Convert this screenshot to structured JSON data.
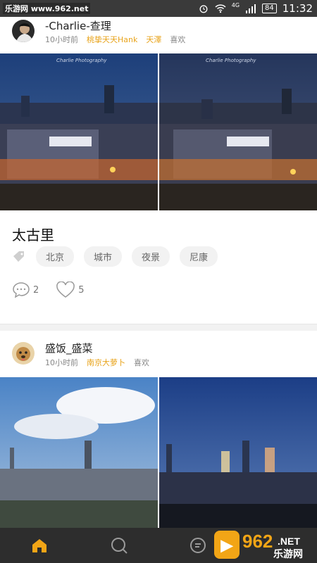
{
  "status_bar": {
    "watermark": "乐游网 www.962.net",
    "network": "4G",
    "battery": "84",
    "time": "11:32"
  },
  "posts": [
    {
      "user": "-Charlie-查理",
      "time": "10小时前",
      "likers": [
        "桃挚天天Hank",
        "天澤"
      ],
      "like_suffix": "喜欢",
      "photo_caption": "Charlie Photography",
      "title": "太古里",
      "tags": [
        "北京",
        "城市",
        "夜景",
        "尼康"
      ],
      "comments": "2",
      "likes": "5"
    },
    {
      "user": "盛饭_盛菜",
      "time": "10小时前",
      "likers": [
        "南京大萝卜"
      ],
      "like_suffix": "喜欢"
    }
  ],
  "nav": {
    "icons": [
      "home-icon",
      "search-icon",
      "message-icon"
    ],
    "accent": "#f2a516"
  },
  "brand": {
    "logo_text": "962",
    "logo_sub": ".NET",
    "logo_caption": "乐游网"
  },
  "colors": {
    "highlight": "#e8a31a",
    "statusbar": "#3a3a3a",
    "navbar": "#2d2d2d"
  }
}
